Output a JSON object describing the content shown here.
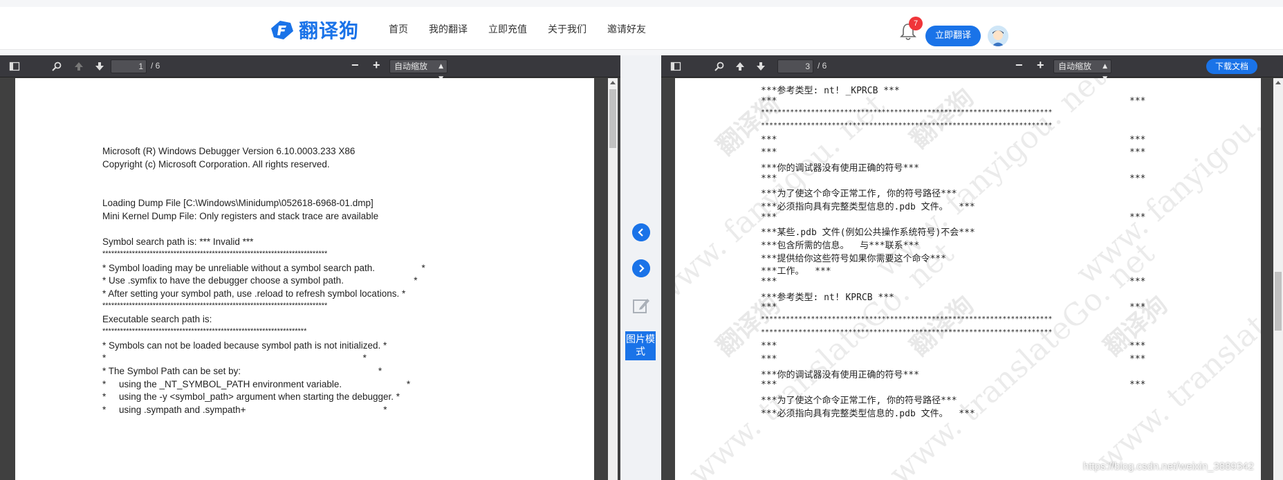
{
  "header": {
    "logo_text": "翻译狗",
    "nav": [
      "首页",
      "我的翻译",
      "立即充值",
      "关于我们",
      "邀请好友"
    ],
    "notification_count": "7",
    "translate_button": "立即翻译"
  },
  "left_viewer": {
    "current_page": "1",
    "page_count": "/ 6",
    "zoom_label": "自动缩放",
    "lines": [
      "Microsoft (R) Windows Debugger Version 6.10.0003.233 X86",
      "Copyright (c) Microsoft Corporation. All rights reserved.",
      "Loading Dump File [C:\\Windows\\Minidump\\052618-6968-01.dmp]",
      "Mini Kernel Dump File: Only registers and stack trace are available",
      "Symbol search path is: *** Invalid ***",
      "****************************************************************************",
      "* Symbol loading may be unreliable without a symbol search path.                  *",
      "* Use .symfix to have the debugger choose a symbol path.                           *",
      "* After setting your symbol path, use .reload to refresh symbol locations. *",
      "****************************************************************************",
      "Executable search path is:",
      "*********************************************************************",
      "* Symbols can not be loaded because symbol path is not initialized. *",
      "*                                                                                                   *",
      "* The Symbol Path can be set by:                                                     *",
      "*     using the _NT_SYMBOL_PATH environment variable.                         *",
      "*     using the -y <symbol_path> argument when starting the debugger. *",
      "*     using .sympath and .sympath+                                                     *"
    ]
  },
  "right_viewer": {
    "current_page": "3",
    "page_count": "/ 6",
    "zoom_label": "自动缩放",
    "download_button": "下载文档",
    "lines": [
      "***参考类型: nt! _KPRCB ***",
      "***",
      "**********************************************************************",
      "**********************************************************************",
      "***",
      "***",
      "***你的调试器没有使用正确的符号***",
      "***",
      "***为了使这个命令正常工作, 你的符号路径***",
      "***必须指向具有完整类型信息的.pdb 文件。  ***",
      "***",
      "***某些.pdb 文件(例如公共操作系统符号)不会***",
      "***包含所需的信息。  与***联系***",
      "***提供给你这些符号如果你需要这个命令***",
      "***工作。  ***",
      "***",
      "***参考类型: nt! KPRCB ***",
      "***",
      "**********************************************************************",
      "**********************************************************************",
      "***",
      "***",
      "***你的调试器没有使用正确的符号***",
      "***",
      "***为了使这个命令正常工作, 你的符号路径***",
      "***必须指向具有完整类型信息的.pdb 文件。  ***"
    ],
    "right_stars": [
      "***",
      "***",
      "***",
      "***",
      "***",
      "***",
      "***",
      "***",
      "***",
      "***",
      "***"
    ],
    "watermark_en": "www. fanyigou. net",
    "watermark_en2": "www. translateGo. net",
    "watermark_cn": "翻译狗"
  },
  "middle": {
    "picture_mode": "图片模式"
  },
  "credit": "https://blog.csdn.net/weixin_3889342"
}
